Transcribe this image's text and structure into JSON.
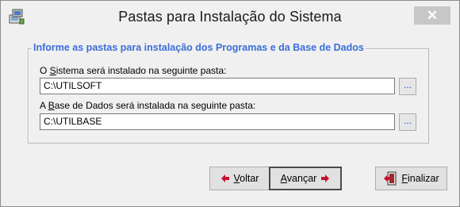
{
  "window": {
    "title": "Pastas para Instalação do Sistema",
    "close_symbol": "✕",
    "app_icon": "setup-icon"
  },
  "group": {
    "legend": "Informe as pastas para instalação dos Programas e da Base de Dados",
    "sistema": {
      "label_prefix": "O ",
      "label_mnemonic": "S",
      "label_rest": "istema será instalado na seguinte pasta:",
      "value": "C:\\UTILSOFT",
      "browse_label": "..."
    },
    "base": {
      "label_prefix": "A ",
      "label_mnemonic": "B",
      "label_rest": "ase de Dados será instalada na seguinte pasta:",
      "value": "C:\\UTILBASE",
      "browse_label": "..."
    }
  },
  "buttons": {
    "voltar": {
      "mnemonic": "V",
      "rest": "oltar",
      "icon": "arrow-left-icon"
    },
    "avancar": {
      "mnemonic": "A",
      "rest": "vançar",
      "icon": "arrow-right-icon"
    },
    "finalizar": {
      "mnemonic": "F",
      "rest": "inalizar",
      "icon": "exit-door-icon"
    }
  },
  "colors": {
    "legend": "#3a6fd8",
    "arrow": "#c8102e",
    "browse_dots": "#1c4ad6"
  }
}
